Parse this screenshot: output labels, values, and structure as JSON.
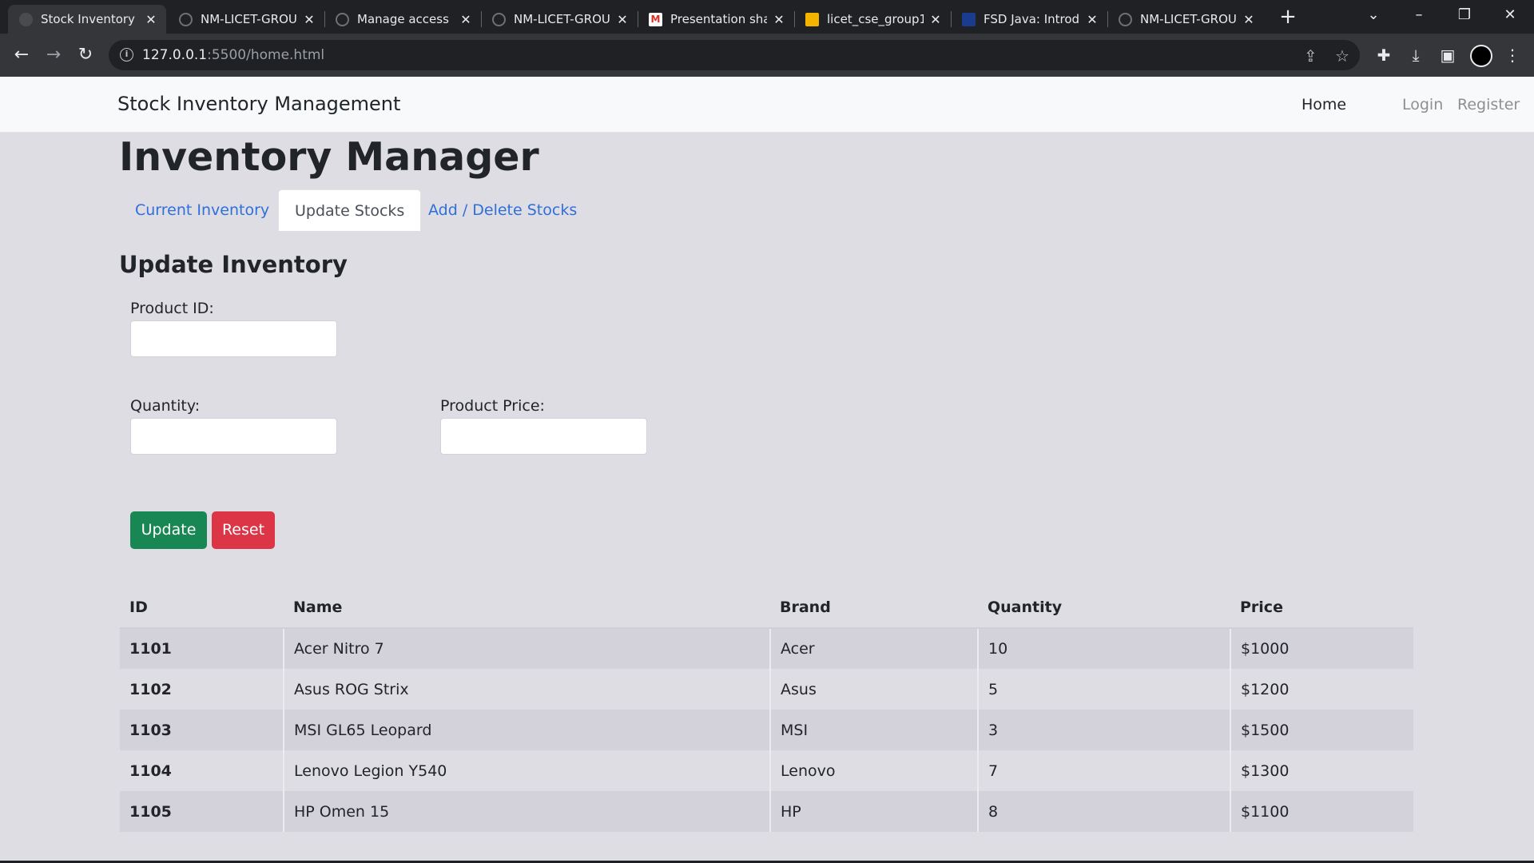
{
  "browser": {
    "tabs": [
      {
        "title": "Stock Inventory M",
        "active": true,
        "favicon": "globe-icon"
      },
      {
        "title": "NM-LICET-GROU",
        "favicon": "github-icon"
      },
      {
        "title": "Manage access",
        "favicon": "github-icon"
      },
      {
        "title": "NM-LICET-GROU",
        "favicon": "github-icon"
      },
      {
        "title": "Presentation sha",
        "favicon": "gmail-icon"
      },
      {
        "title": "licet_cse_group1",
        "favicon": "slides-icon"
      },
      {
        "title": "FSD Java: Introdu",
        "favicon": "course-icon"
      },
      {
        "title": "NM-LICET-GROU",
        "favicon": "github-icon"
      }
    ],
    "url_host": "127.0.0.1",
    "url_path": ":5500/home.html"
  },
  "navbar": {
    "brand": "Stock Inventory Management",
    "links": [
      "Home",
      "Login",
      "Register"
    ],
    "active_link": "Home"
  },
  "page": {
    "title": "Inventory Manager",
    "tabs": [
      "Current Inventory",
      "Update Stocks",
      "Add / Delete Stocks"
    ],
    "active_tab": "Update Stocks"
  },
  "form": {
    "heading": "Update Inventory",
    "product_id_label": "Product ID:",
    "quantity_label": "Quantity:",
    "price_label": "Product Price:",
    "product_id_value": "",
    "quantity_value": "",
    "price_value": "",
    "update_label": "Update",
    "reset_label": "Reset"
  },
  "table": {
    "headers": [
      "ID",
      "Name",
      "Brand",
      "Quantity",
      "Price"
    ],
    "rows": [
      [
        "1101",
        "Acer Nitro 7",
        "Acer",
        "10",
        "$1000"
      ],
      [
        "1102",
        "Asus ROG Strix",
        "Asus",
        "5",
        "$1200"
      ],
      [
        "1103",
        "MSI GL65 Leopard",
        "MSI",
        "3",
        "$1500"
      ],
      [
        "1104",
        "Lenovo Legion Y540",
        "Lenovo",
        "7",
        "$1300"
      ],
      [
        "1105",
        "HP Omen 15",
        "HP",
        "8",
        "$1100"
      ]
    ]
  },
  "colors": {
    "page_bg": "#dedde4",
    "link": "#2f6fd9",
    "update_button": "#198754",
    "reset_button": "#dc3545"
  }
}
